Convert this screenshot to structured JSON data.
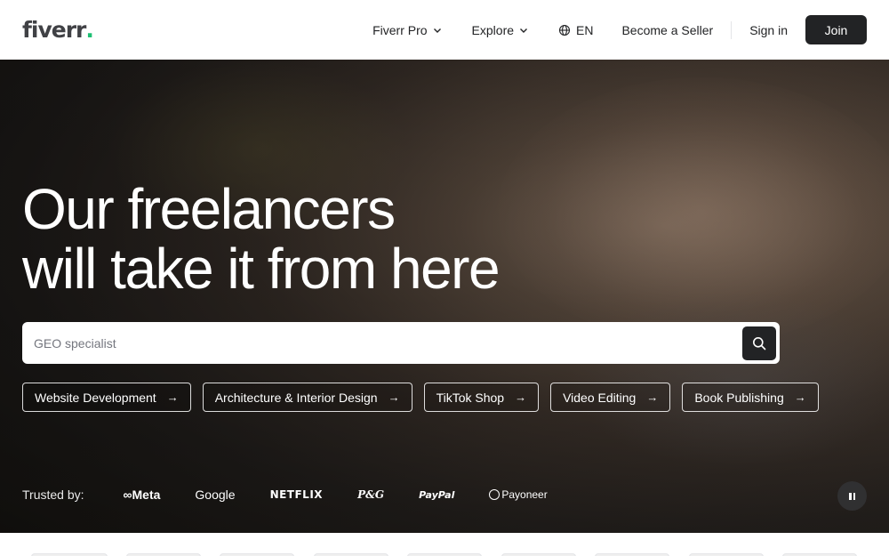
{
  "header": {
    "logo": "fiverr",
    "logo_dot": ".",
    "nav": {
      "fiverr_pro": "Fiverr Pro",
      "explore": "Explore",
      "language": "EN",
      "become_seller": "Become a Seller",
      "sign_in": "Sign in",
      "join": "Join"
    }
  },
  "hero": {
    "title_line1": "Our freelancers",
    "title_line2": "will take it from here",
    "search": {
      "placeholder": "GEO specialist"
    },
    "chips": [
      {
        "label": "Website Development",
        "arrow": "→"
      },
      {
        "label": "Architecture & Interior Design",
        "arrow": "→"
      },
      {
        "label": "TikTok Shop",
        "arrow": "→"
      },
      {
        "label": "Video Editing",
        "arrow": "→"
      },
      {
        "label": "Book Publishing",
        "arrow": "→"
      }
    ],
    "trusted": {
      "label": "Trusted by:",
      "brands": [
        "∞Meta",
        "Google",
        "NETFLIX",
        "P&G",
        "PayPal",
        "Payoneer"
      ]
    }
  },
  "icons": {
    "search": "search-icon",
    "globe": "globe-icon",
    "chevron": "chevron-down-icon",
    "pause": "pause-icon"
  },
  "colors": {
    "brand_dot": "#1dbf73",
    "dark_button": "#222325"
  }
}
